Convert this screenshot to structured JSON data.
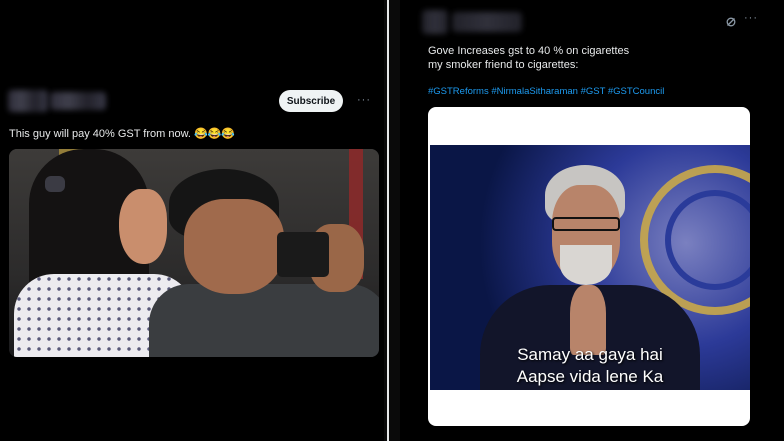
{
  "left_post": {
    "subscribe_label": "Subscribe",
    "more_icon": "···",
    "text": "This guy will pay 40% GST from now. 😂😂😂"
  },
  "right_post": {
    "more_icon": "···",
    "text_line1": "Gove Increases gst to 40 % on cigarettes",
    "text_line2": "my smoker friend to cigarettes:",
    "hashtags": "#GSTReforms #NirmalaSitharaman #GST #GSTCouncil",
    "meme_caption_line1": "Samay aa gaya hai",
    "meme_caption_line2": "Aapse vida lene Ka"
  },
  "colors": {
    "background": "#000000",
    "text": "#e7e9ea",
    "link": "#1d9bf0",
    "subscribe_bg": "#eff3f4"
  }
}
